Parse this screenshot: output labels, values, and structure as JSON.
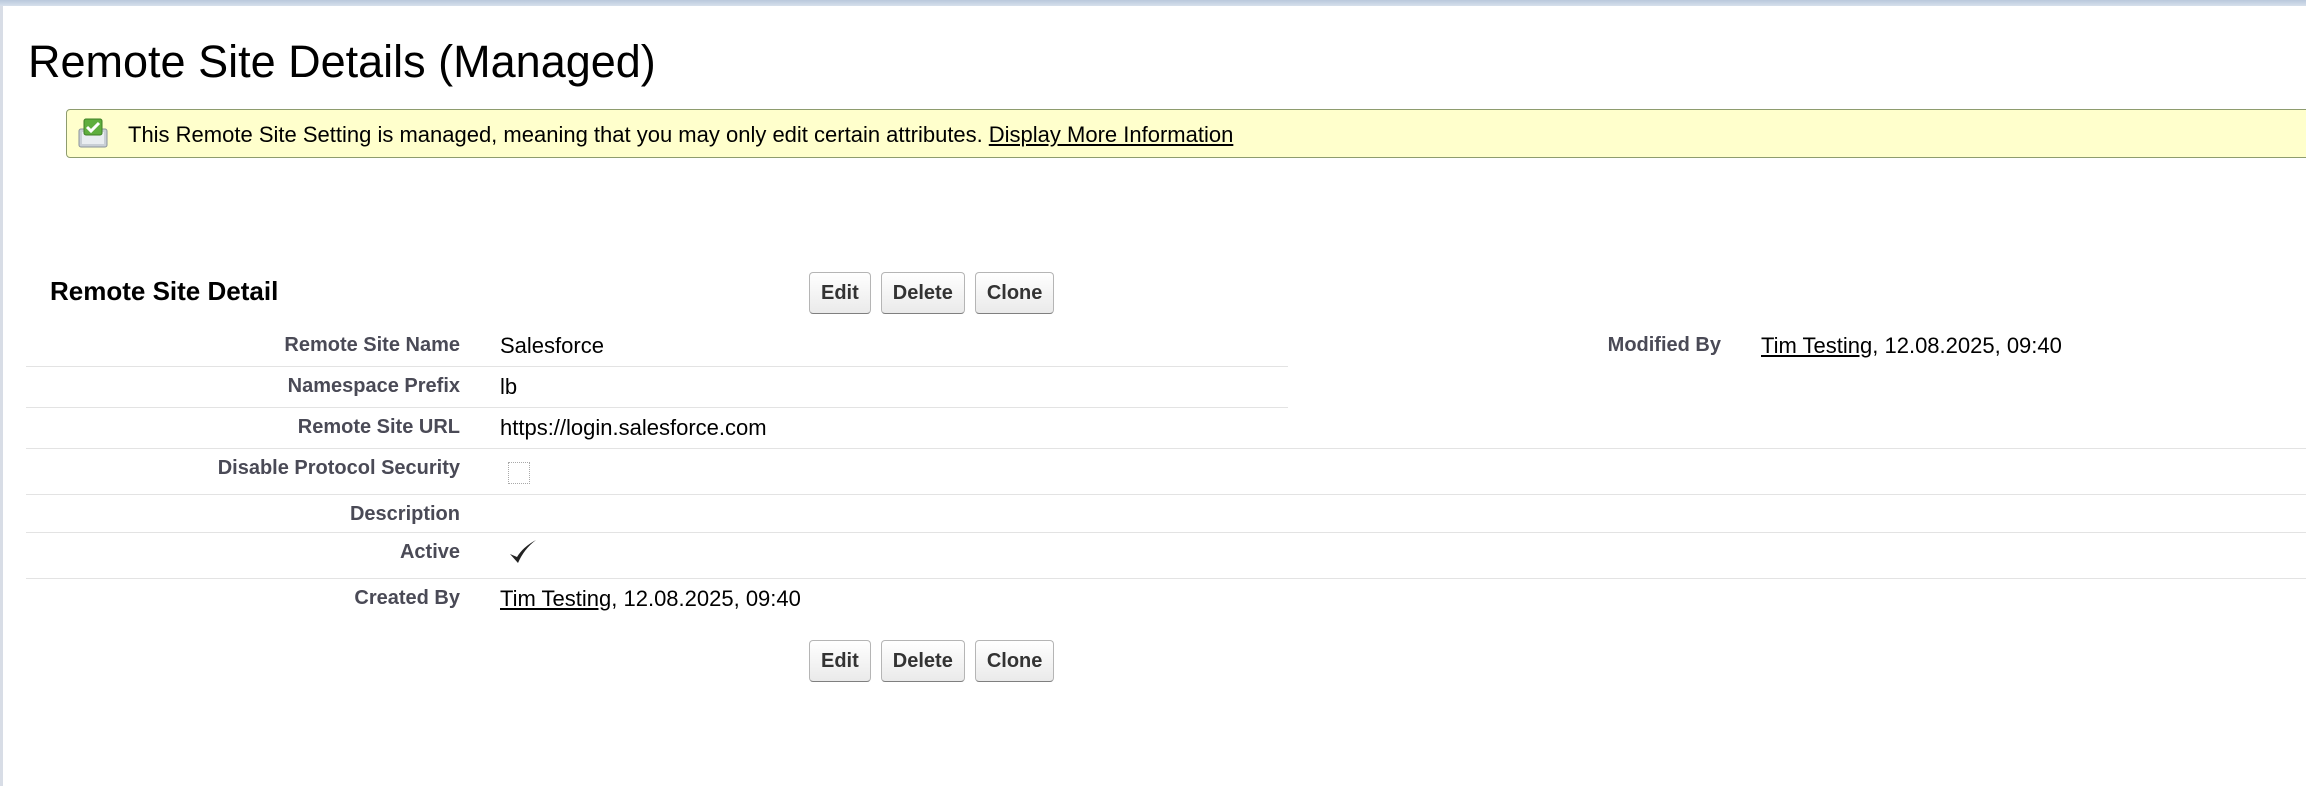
{
  "page": {
    "title": "Remote Site Details (Managed)"
  },
  "message": {
    "text": "This Remote Site Setting is managed, meaning that you may only edit certain attributes.",
    "link": "Display More Information",
    "icon": "managed-package-check-icon"
  },
  "section": {
    "title": "Remote Site Detail"
  },
  "buttons": {
    "edit": "Edit",
    "delete": "Delete",
    "clone": "Clone"
  },
  "fields": {
    "remote_site_name": {
      "label": "Remote Site Name",
      "value": "Salesforce"
    },
    "namespace_prefix": {
      "label": "Namespace Prefix",
      "value": "lb"
    },
    "remote_site_url": {
      "label": "Remote Site URL",
      "value": "https://login.salesforce.com"
    },
    "disable_protocol_security": {
      "label": "Disable Protocol Security",
      "checked": false
    },
    "description": {
      "label": "Description",
      "value": ""
    },
    "active": {
      "label": "Active",
      "checked": true
    },
    "created_by": {
      "label": "Created By",
      "user": "Tim Testing",
      "date": ", 12.08.2025, 09:40"
    },
    "modified_by": {
      "label": "Modified By",
      "user": "Tim Testing",
      "date": ", 12.08.2025, 09:40"
    }
  },
  "colors": {
    "message_bg": "#ffffcc",
    "label_text": "#4a4a56",
    "divider": "#e3e3e3"
  }
}
